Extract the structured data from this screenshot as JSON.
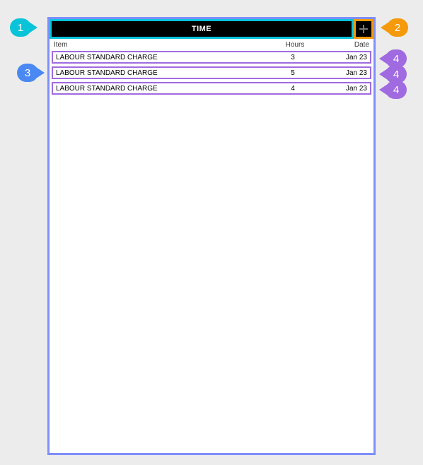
{
  "title": "TIME",
  "columns": {
    "item": "Item",
    "hours": "Hours",
    "date": "Date"
  },
  "rows": [
    {
      "item": "LABOUR STANDARD CHARGE",
      "hours": "3",
      "date": "Jan 23"
    },
    {
      "item": "LABOUR STANDARD CHARGE",
      "hours": "5",
      "date": "Jan 23"
    },
    {
      "item": "LABOUR STANDARD CHARGE",
      "hours": "4",
      "date": "Jan 23"
    }
  ],
  "callouts": {
    "c1": "1",
    "c2": "2",
    "c3": "3",
    "c4": "4"
  }
}
